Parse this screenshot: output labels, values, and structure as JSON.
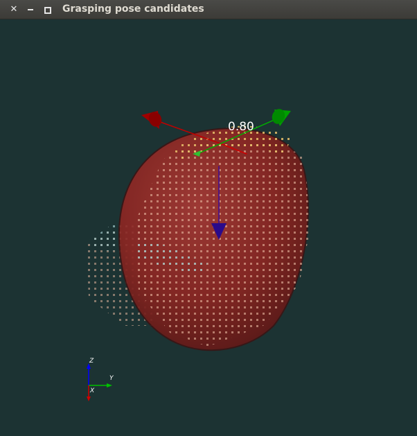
{
  "window": {
    "title": "Grasping pose candidates",
    "close_glyph": "✕",
    "minimize_icon": "minimize-icon",
    "maximize_icon": "maximize-icon"
  },
  "scene": {
    "background": "#1c3333",
    "object_color": "#8b1f1f",
    "score_label": "0.80",
    "gripper_axes": {
      "x_color": "#b00000",
      "y_color": "#00a000",
      "approach_color": "#2a0a8a"
    }
  },
  "axes_widget": {
    "z_label": "Z",
    "y_label": "Y",
    "x_label": "X",
    "z_color": "#0000ff",
    "y_color": "#00c000",
    "x_color": "#d00000"
  }
}
